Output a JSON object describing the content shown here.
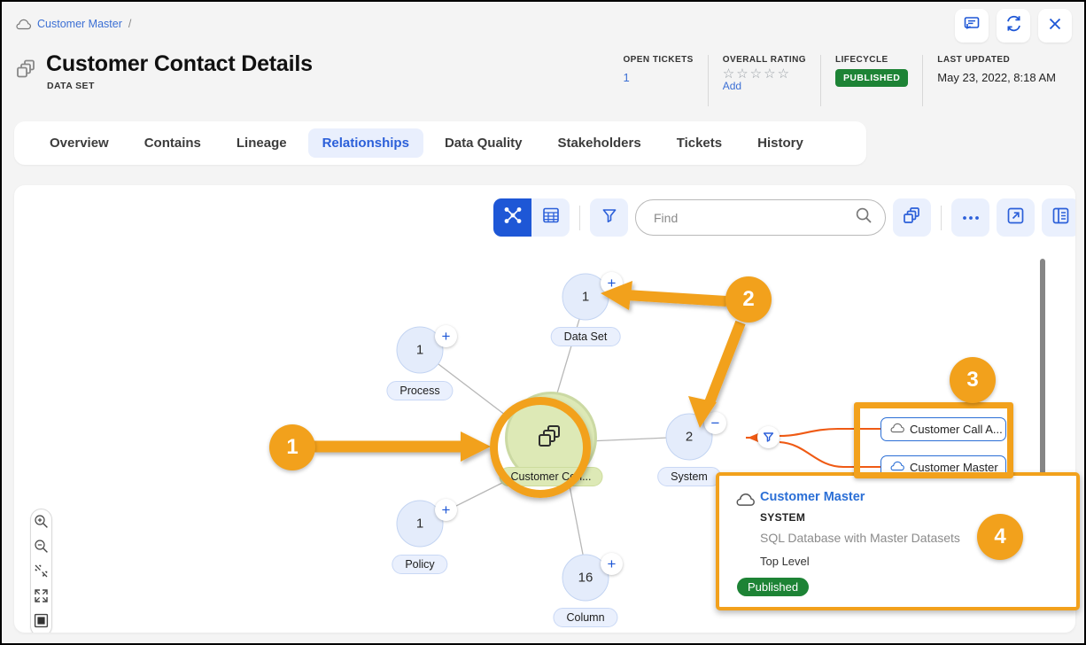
{
  "breadcrumb": {
    "icon": "cloud-icon",
    "label": "Customer Master",
    "separator": "/"
  },
  "window_buttons": [
    {
      "name": "comment-icon",
      "label": "Comments"
    },
    {
      "name": "refresh-icon",
      "label": "Refresh"
    },
    {
      "name": "close-icon",
      "label": "Close"
    }
  ],
  "header": {
    "icon": "data-set-icon",
    "title": "Customer Contact Details",
    "subtitle": "DATA SET",
    "metrics": [
      {
        "label": "OPEN TICKETS",
        "value": "1",
        "type": "link"
      },
      {
        "label": "OVERALL RATING",
        "stars": 5,
        "filled": 0,
        "action": "Add",
        "type": "rating"
      },
      {
        "label": "LIFECYCLE",
        "value": "PUBLISHED",
        "type": "badge",
        "color": "#1d8335"
      },
      {
        "label": "LAST UPDATED",
        "value": "May 23, 2022, 8:18 AM",
        "type": "text"
      }
    ]
  },
  "tabs": [
    {
      "label": "Overview",
      "active": false
    },
    {
      "label": "Contains",
      "active": false
    },
    {
      "label": "Lineage",
      "active": false
    },
    {
      "label": "Relationships",
      "active": true
    },
    {
      "label": "Data Quality",
      "active": false
    },
    {
      "label": "Stakeholders",
      "active": false
    },
    {
      "label": "Tickets",
      "active": false
    },
    {
      "label": "History",
      "active": false
    }
  ],
  "graph_toolbar": {
    "view_graph": {
      "icon": "graph-view-icon",
      "selected": true
    },
    "view_table": {
      "icon": "table-view-icon",
      "selected": false
    },
    "filter": {
      "icon": "filter-funnel-icon"
    },
    "search": {
      "placeholder": "Find",
      "value": "",
      "icon": "search-icon"
    },
    "layers": {
      "icon": "layers-icon"
    },
    "more": {
      "icon": "ellipsis-icon"
    },
    "open_external": {
      "icon": "open-external-icon"
    },
    "side_panel": {
      "icon": "side-panel-icon"
    }
  },
  "zoom_controls": [
    {
      "name": "zoom-in-icon"
    },
    {
      "name": "zoom-out-icon"
    },
    {
      "name": "zoom-collapse-icon"
    },
    {
      "name": "fit-screen-icon"
    },
    {
      "name": "minimap-icon"
    }
  ],
  "graph": {
    "center_node": {
      "label": "Customer Con...",
      "icon": "data-set-icon",
      "color": "#dde9b6"
    },
    "nodes": [
      {
        "label": "Process",
        "count": "1",
        "badge": "+"
      },
      {
        "label": "Data Set",
        "count": "1",
        "badge": "+"
      },
      {
        "label": "System",
        "count": "2",
        "badge": "−"
      },
      {
        "label": "Policy",
        "count": "1",
        "badge": "+"
      },
      {
        "label": "Column",
        "count": "16",
        "badge": "+"
      }
    ],
    "related_items": [
      {
        "label": "Customer Call A...",
        "icon": "cloud-icon"
      },
      {
        "label": "Customer Master",
        "icon": "cloud-icon"
      }
    ]
  },
  "tooltip": {
    "icon": "cloud-icon",
    "title": "Customer Master",
    "type": "SYSTEM",
    "description": "SQL Database with Master Datasets",
    "level": "Top Level",
    "status": "Published"
  },
  "annotations": [
    {
      "number": "1"
    },
    {
      "number": "2"
    },
    {
      "number": "3"
    },
    {
      "number": "4"
    }
  ],
  "colors": {
    "accent_blue": "#1e57d6",
    "annotation_orange": "#f2a11c",
    "published_green": "#1d8335",
    "edge_orange": "#ef5a14"
  }
}
